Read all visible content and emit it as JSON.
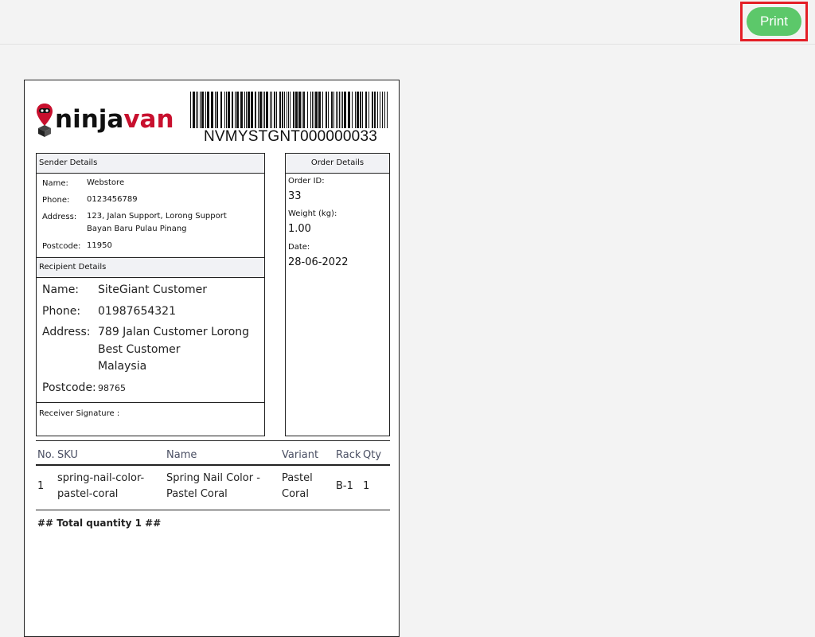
{
  "toolbar": {
    "print_label": "Print"
  },
  "label": {
    "logo": {
      "text_main": "ninja",
      "text_accent": "van",
      "icon": "ninja-pin-icon",
      "accent_color": "#c8102e"
    },
    "tracking_number": "NVMYSTGNT000000033",
    "sender": {
      "header": "Sender Details",
      "name_label": "Name:",
      "name": "Webstore",
      "phone_label": "Phone:",
      "phone": "0123456789",
      "address_label": "Address:",
      "address_line1": "123, Jalan Support, Lorong Support",
      "address_line2": "Bayan Baru Pulau Pinang",
      "postcode_label": "Postcode:",
      "postcode": "11950"
    },
    "recipient": {
      "header": "Recipient Details",
      "name_label": "Name:",
      "name": "SiteGiant Customer",
      "phone_label": "Phone:",
      "phone": "01987654321",
      "address_label": "Address:",
      "address_line1": "789 Jalan Customer Lorong",
      "address_line2": "Best Customer",
      "address_line3": "Malaysia",
      "postcode_label": "Postcode:",
      "postcode": "98765"
    },
    "signature_label": "Receiver Signature :",
    "order": {
      "header": "Order Details",
      "order_id_label": "Order ID:",
      "order_id": "33",
      "weight_label": "Weight (kg):",
      "weight": "1.00",
      "date_label": "Date:",
      "date": "28-06-2022"
    },
    "items": {
      "columns": {
        "no": "No.",
        "sku": "SKU",
        "name": "Name",
        "variant": "Variant",
        "rack": "Rack",
        "qty": "Qty"
      },
      "rows": [
        {
          "no": "1",
          "sku_line1": "spring-nail-color-",
          "sku_line2": "pastel-coral",
          "name_line1": "Spring Nail Color -",
          "name_line2": "Pastel Coral",
          "variant_line1": "Pastel",
          "variant_line2": "Coral",
          "rack": "B-1",
          "qty": "1"
        }
      ],
      "total": "## Total quantity 1 ##"
    }
  }
}
